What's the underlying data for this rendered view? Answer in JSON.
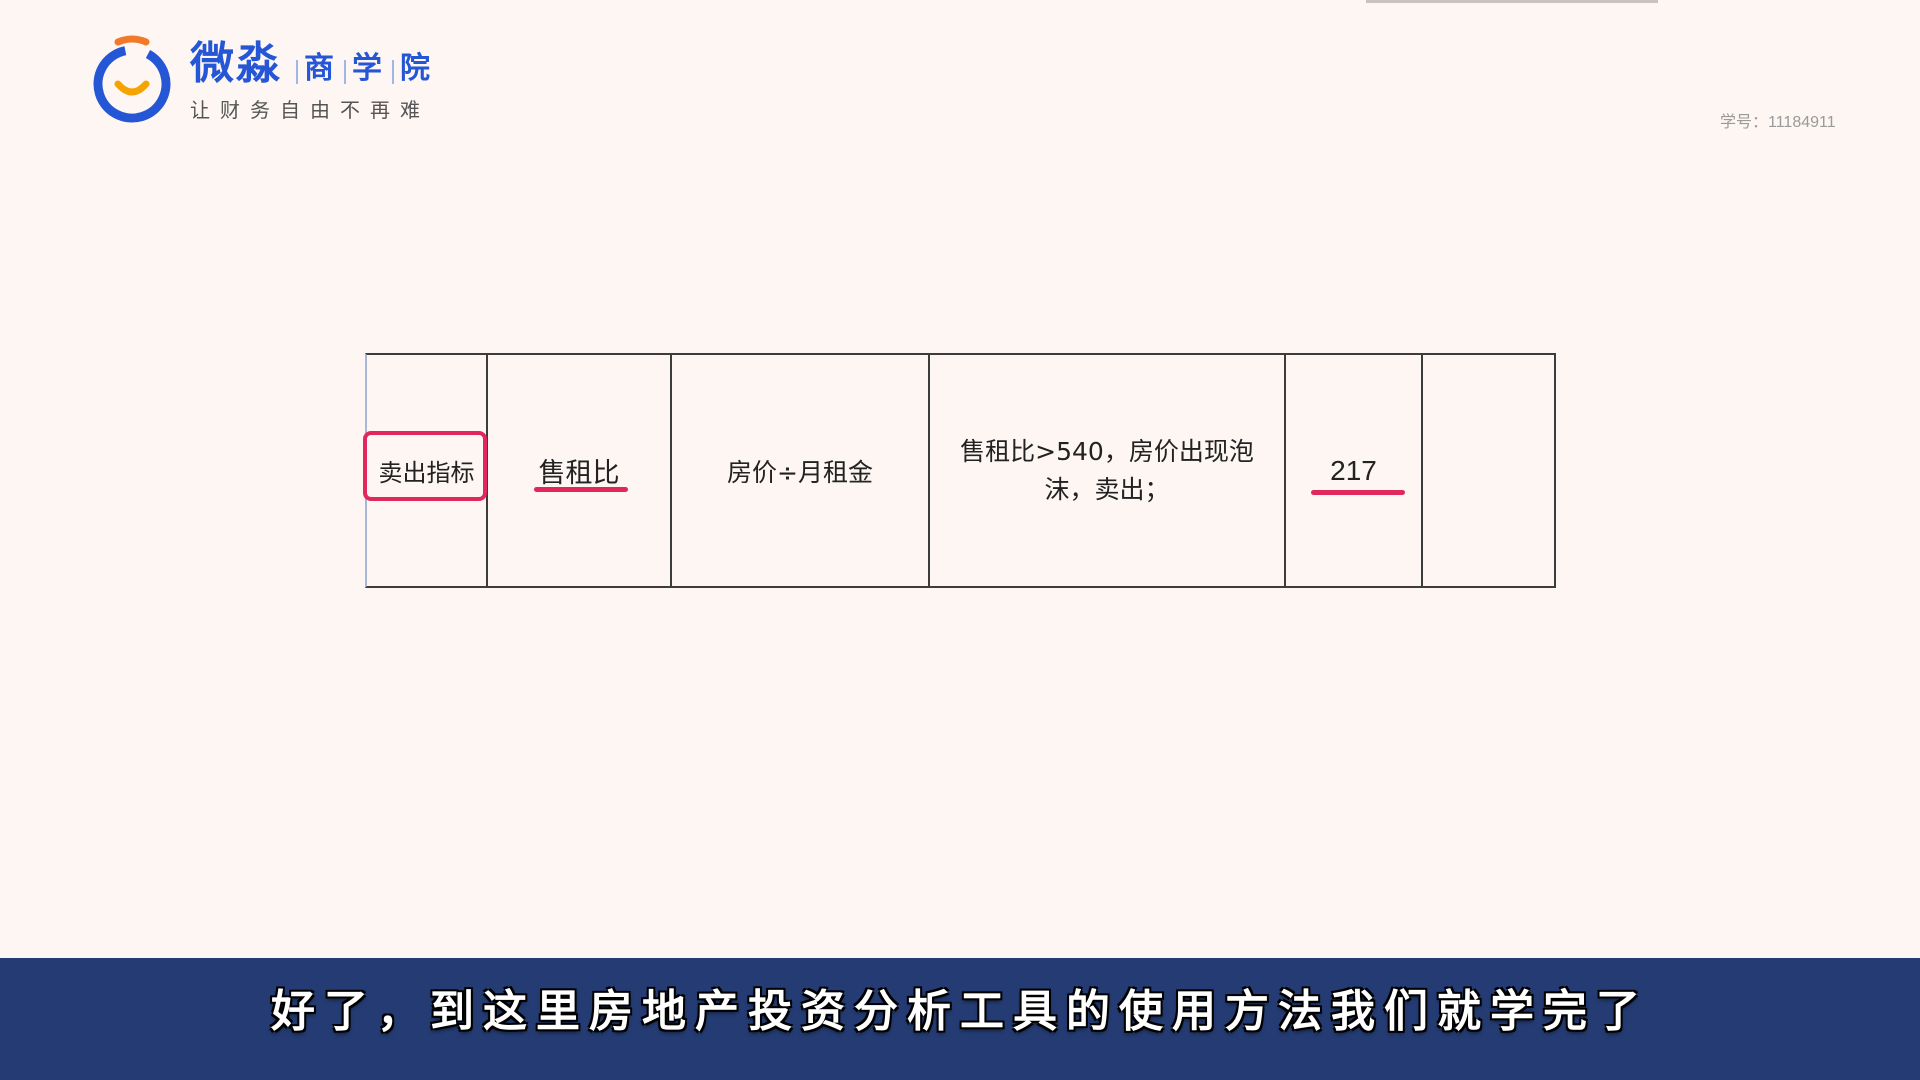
{
  "brand": {
    "name": "微淼",
    "sub": [
      "商",
      "学",
      "院"
    ],
    "slogan": "让财务自由不再难",
    "colors": {
      "primary": "#2456d6",
      "accent": "#f07a2a"
    }
  },
  "student_id": "学号：11184911",
  "table": {
    "cells": [
      "卖出指标",
      "售租比",
      "房价÷月租金",
      "售租比>540，房价出现泡沫，卖出；",
      "217",
      ""
    ],
    "highlight_color": "#e0285c"
  },
  "subtitle": "好了，到这里房地产投资分析工具的使用方法我们就学完了"
}
